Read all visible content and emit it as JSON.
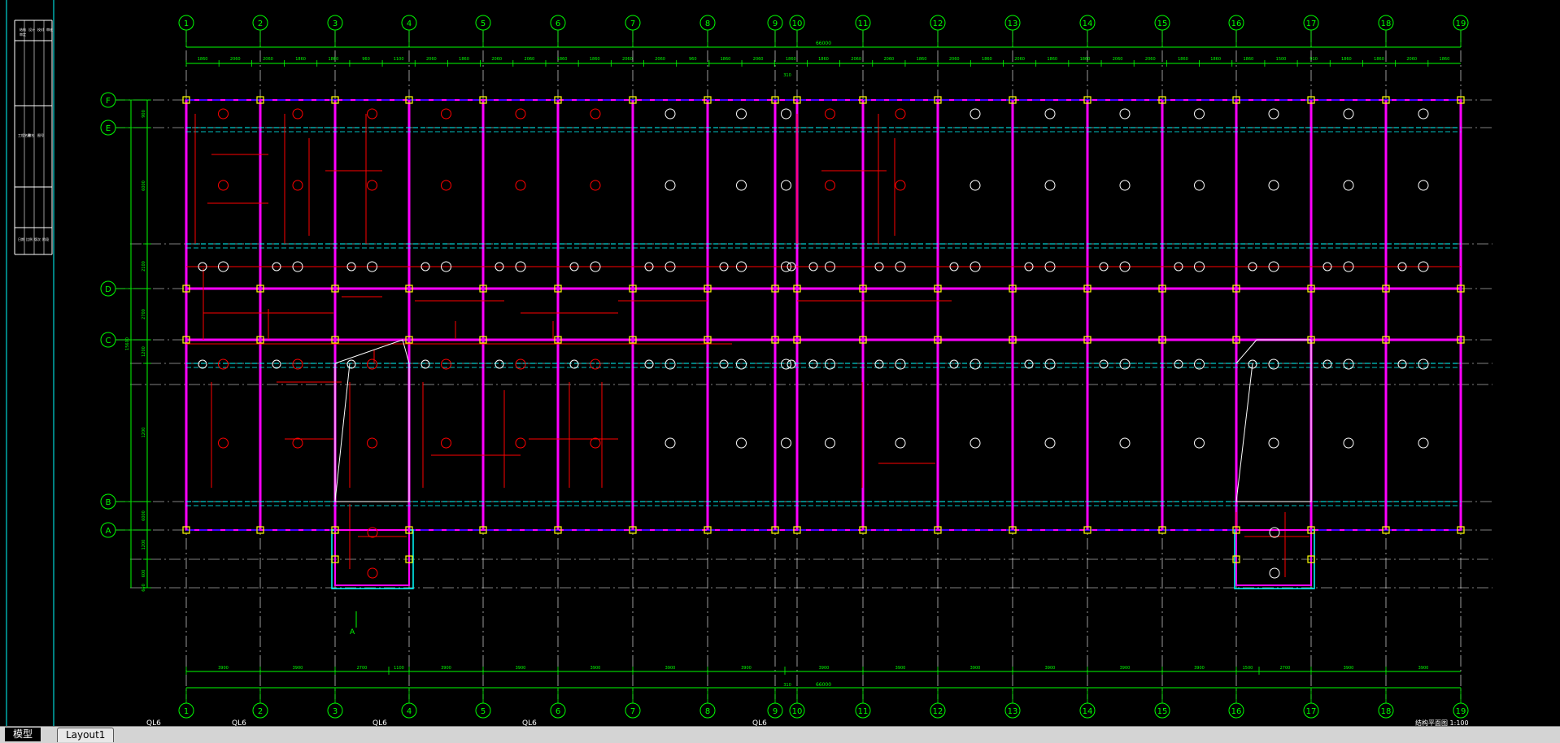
{
  "title_block": {
    "top_cells": [
      "结构",
      "设计",
      "校对",
      "审核",
      "审定"
    ],
    "mid_cells": [
      "工程名称",
      "图名",
      "图号"
    ],
    "low_cells": [
      "日期",
      "比例",
      "版次",
      "阶段"
    ]
  },
  "grid": {
    "columns": [
      "1",
      "2",
      "3",
      "4",
      "5",
      "6",
      "7",
      "8",
      "9",
      "10",
      "11",
      "12",
      "13",
      "14",
      "15",
      "16",
      "17",
      "18",
      "19"
    ],
    "rows": [
      "F",
      "E",
      "D",
      "C",
      "B",
      "A"
    ]
  },
  "dimensions": {
    "top_total": "66000",
    "top_spans": [
      "1860",
      "2060",
      "2060",
      "1860",
      "1860",
      "960",
      "1100",
      "2060",
      "1860",
      "2060",
      "2060",
      "1860",
      "1860",
      "2060",
      "2060",
      "960",
      "1860",
      "2060",
      "1860",
      "1860",
      "2060",
      "2060",
      "1860",
      "2060",
      "1860",
      "2060",
      "1860",
      "1860",
      "2060",
      "2060",
      "1860",
      "1860",
      "1860",
      "1500",
      "910",
      "1860",
      "1860",
      "2060",
      "1860"
    ],
    "top_axis_offset": "310",
    "bottom_total": "66000",
    "bottom_spans": [
      "3900",
      "3900",
      "2700",
      "1100",
      "3900",
      "3900",
      "3900",
      "3900",
      "3900",
      "3900",
      "3900",
      "3900",
      "3900",
      "3900",
      "3900",
      "1500",
      "2700",
      "3900",
      "3900"
    ],
    "bottom_axis_offset": "310",
    "left_spans": [
      "900",
      "6000",
      "2100",
      "2700",
      "1200",
      "1200",
      "6000",
      "1200",
      "600",
      "600"
    ],
    "left_total": "15600"
  },
  "labels": {
    "section_mark": "A",
    "bottom_notes": [
      "QL6",
      "QL6",
      "QL6",
      "QL6",
      "QL6"
    ],
    "bottom_right_note": "结构平面图  1:100"
  },
  "tabs": {
    "model": "模型",
    "layout1": "Layout1"
  },
  "colors": {
    "background": "#000000",
    "axis": "#00ff00",
    "beam": "#ff00ff",
    "slab": "#ff0000",
    "column": "#ffff00",
    "cyan": "#00ffff",
    "wall": "#0000ff",
    "white": "#ffffff"
  }
}
